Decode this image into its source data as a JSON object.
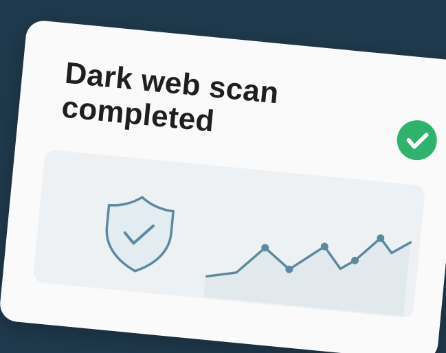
{
  "card": {
    "title_line1": "Dark web scan",
    "title_line2": "completed"
  },
  "colors": {
    "background": "#1f3a4d",
    "card": "#fafafb",
    "panel": "#eef1f3",
    "success": "#2db36b",
    "illustration": "#5b8a9f"
  },
  "icons": {
    "status": "checkmark-circle-icon",
    "shield": "shield-check-icon",
    "trend": "trend-line-illustration"
  }
}
